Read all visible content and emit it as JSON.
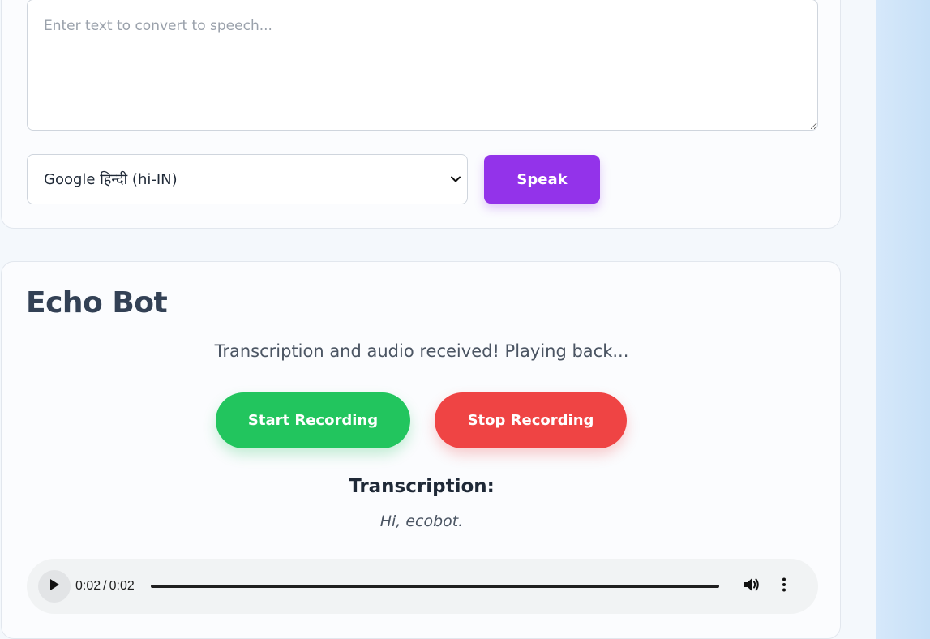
{
  "tts": {
    "text_placeholder": "Enter text to convert to speech...",
    "text_value": "",
    "voice_selected": "Google हिन्दी (hi-IN)",
    "speak_label": "Speak"
  },
  "echo": {
    "title": "Echo Bot",
    "status": "Transcription and audio received! Playing back...",
    "start_label": "Start Recording",
    "stop_label": "Stop Recording",
    "transcription_heading": "Transcription:",
    "transcription_text": "Hi, ecobot.",
    "audio": {
      "current_time": "0:02",
      "duration": "0:02",
      "progress": 1.0
    }
  },
  "icons": {
    "voice_dropdown": "chevron-down-icon",
    "play": "play-icon",
    "volume": "volume-icon",
    "more": "more-vertical-icon"
  },
  "colors": {
    "speak_button": "#9333ea",
    "start_button": "#22c55e",
    "stop_button": "#ef4444",
    "title_text": "#334155"
  }
}
